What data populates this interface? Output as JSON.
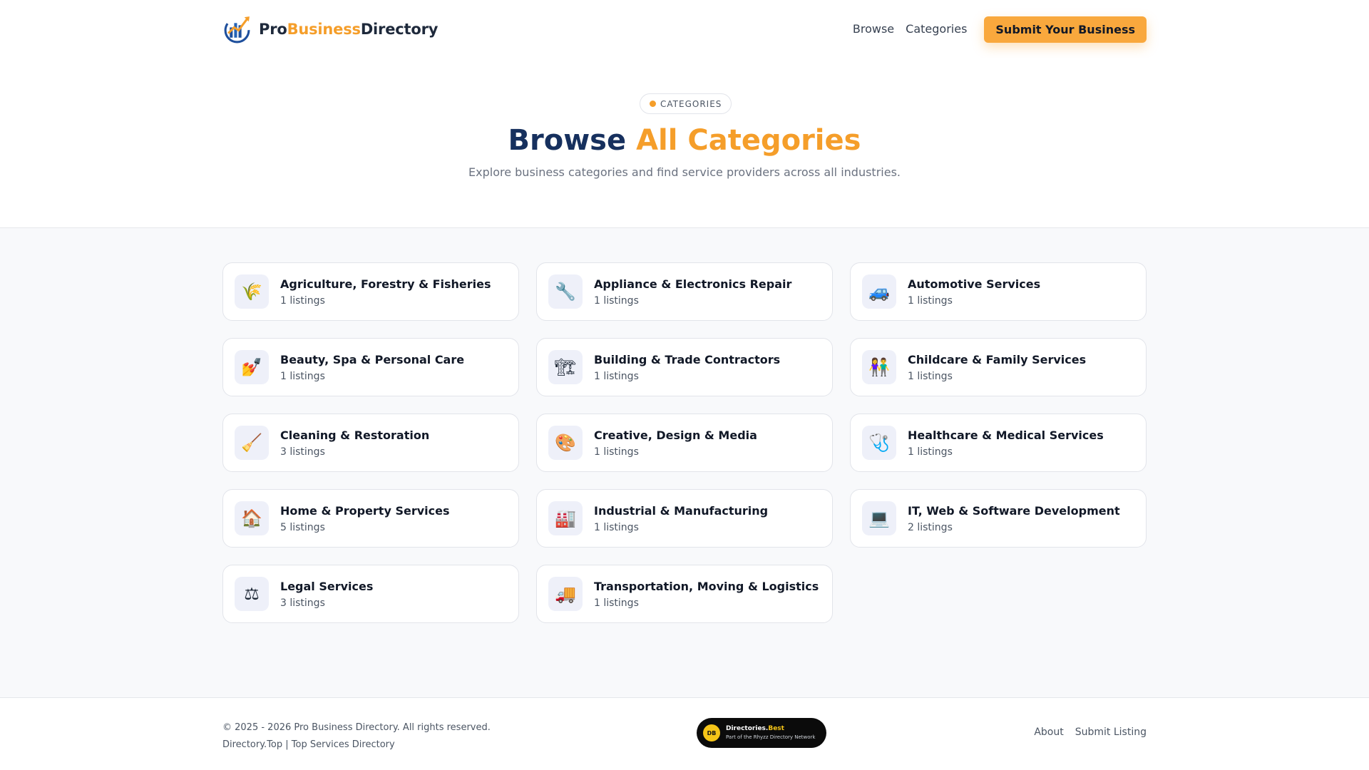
{
  "header": {
    "logo": {
      "part1": "Pro",
      "part2": "Business",
      "part3": "Directory"
    },
    "nav": {
      "browse": "Browse",
      "categories": "Categories",
      "submit": "Submit Your Business"
    }
  },
  "hero": {
    "pill": "CATEGORIES",
    "title_part1": "Browse",
    "title_part2": "All Categories",
    "subtitle": "Explore business categories and find service providers across all industries."
  },
  "categories": [
    {
      "name": "Agriculture, Forestry & Fisheries",
      "count": "1 listings",
      "icon": "🌾",
      "icon_name": "wheat-icon"
    },
    {
      "name": "Appliance & Electronics Repair",
      "count": "1 listings",
      "icon": "🔧",
      "icon_name": "wrench-icon"
    },
    {
      "name": "Automotive Services",
      "count": "1 listings",
      "icon": "🚙",
      "icon_name": "car-icon"
    },
    {
      "name": "Beauty, Spa & Personal Care",
      "count": "1 listings",
      "icon": "💅",
      "icon_name": "nail-polish-icon"
    },
    {
      "name": "Building & Trade Contractors",
      "count": "1 listings",
      "icon": "🏗",
      "icon_name": "crane-icon"
    },
    {
      "name": "Childcare & Family Services",
      "count": "1 listings",
      "icon": "👫",
      "icon_name": "family-icon"
    },
    {
      "name": "Cleaning & Restoration",
      "count": "3 listings",
      "icon": "🧹",
      "icon_name": "broom-icon"
    },
    {
      "name": "Creative, Design & Media",
      "count": "1 listings",
      "icon": "🎨",
      "icon_name": "palette-icon"
    },
    {
      "name": "Healthcare & Medical Services",
      "count": "1 listings",
      "icon": "🩺",
      "icon_name": "stethoscope-icon"
    },
    {
      "name": "Home & Property Services",
      "count": "5 listings",
      "icon": "🏠",
      "icon_name": "house-icon"
    },
    {
      "name": "Industrial & Manufacturing",
      "count": "1 listings",
      "icon": "🏭",
      "icon_name": "factory-icon"
    },
    {
      "name": "IT, Web & Software Development",
      "count": "2 listings",
      "icon": "💻",
      "icon_name": "laptop-icon"
    },
    {
      "name": "Legal Services",
      "count": "3 listings",
      "icon": "⚖",
      "icon_name": "scales-icon"
    },
    {
      "name": "Transportation, Moving & Logistics",
      "count": "1 listings",
      "icon": "🚚",
      "icon_name": "truck-icon"
    }
  ],
  "footer": {
    "copyright": "© 2025 - 2026 Pro Business Directory. All rights reserved.",
    "link_line": "Directory.Top | Top Services Directory",
    "badge": {
      "circle": "DB",
      "title1": "Directories.",
      "title2": "Best",
      "sub": "Part of the Rhyzz Directory Network"
    },
    "about": "About",
    "submit_listing": "Submit Listing"
  },
  "colors": {
    "accent": "#f59e2a",
    "navy": "#16305e",
    "button": "#f9a83d"
  }
}
